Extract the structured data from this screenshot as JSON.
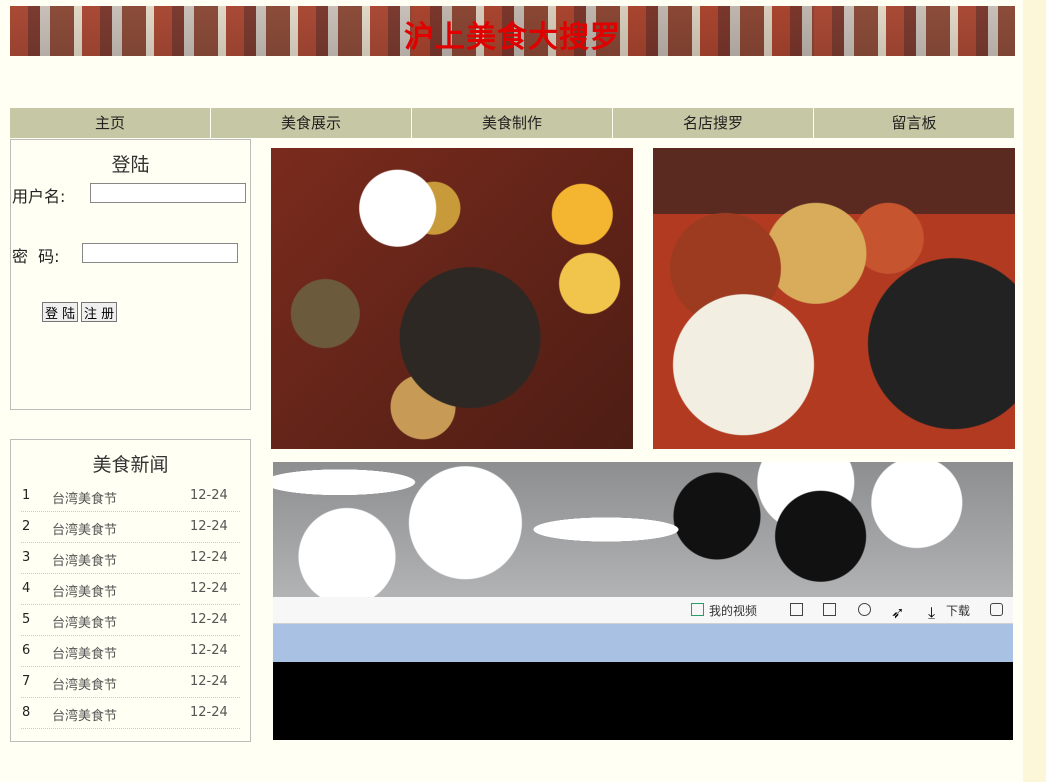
{
  "header": {
    "title": "沪上美食大搜罗"
  },
  "nav": {
    "items": [
      {
        "label": "主页"
      },
      {
        "label": "美食展示"
      },
      {
        "label": "美食制作"
      },
      {
        "label": "名店搜罗"
      },
      {
        "label": "留言板"
      }
    ]
  },
  "login": {
    "title": "登陆",
    "username_label": "用户名:",
    "password_label": "密  码:",
    "login_button": "登 陆",
    "register_button": "注 册"
  },
  "news": {
    "title": "美食新闻",
    "items": [
      {
        "num": "1",
        "text": "台湾美食节",
        "date": "12-24"
      },
      {
        "num": "2",
        "text": "台湾美食节",
        "date": "12-24"
      },
      {
        "num": "3",
        "text": "台湾美食节",
        "date": "12-24"
      },
      {
        "num": "4",
        "text": "台湾美食节",
        "date": "12-24"
      },
      {
        "num": "5",
        "text": "台湾美食节",
        "date": "12-24"
      },
      {
        "num": "6",
        "text": "台湾美食节",
        "date": "12-24"
      },
      {
        "num": "7",
        "text": "台湾美食节",
        "date": "12-24"
      },
      {
        "num": "8",
        "text": "台湾美食节",
        "date": "12-24"
      }
    ]
  },
  "video_player": {
    "my_video_label": "我的视频",
    "download_label": "下载"
  }
}
